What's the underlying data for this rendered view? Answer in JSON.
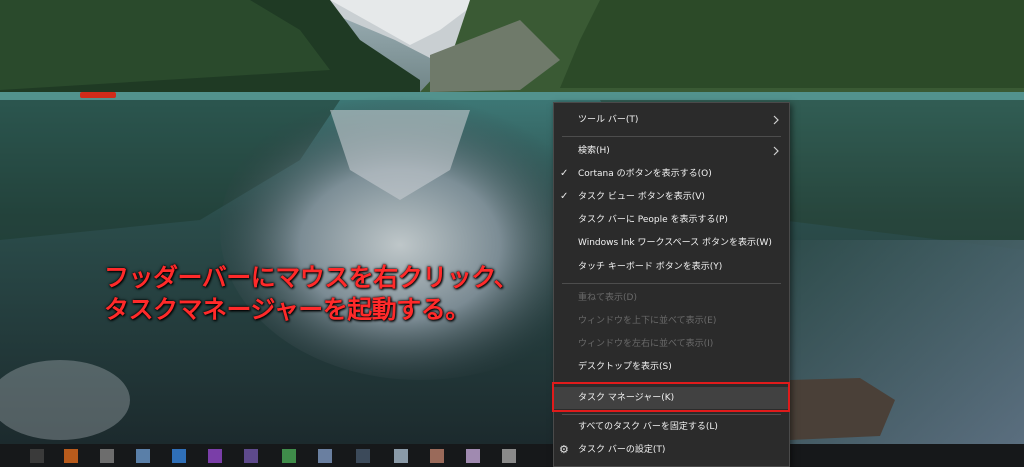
{
  "annotation": {
    "line1": "フッダーバーにマウスを右クリック、",
    "line2": "タスクマネージャーを起動する。"
  },
  "context_menu": {
    "items": [
      {
        "label": "ツール バー(T)",
        "checked": false,
        "disabled": false,
        "submenu": true
      },
      {
        "label": "検索(H)",
        "checked": false,
        "disabled": false,
        "submenu": true
      },
      {
        "label": "Cortana のボタンを表示する(O)",
        "checked": true,
        "disabled": false
      },
      {
        "label": "タスク ビュー ボタンを表示(V)",
        "checked": true,
        "disabled": false
      },
      {
        "label": "タスク バーに People を表示する(P)",
        "checked": false,
        "disabled": false
      },
      {
        "label": "Windows Ink ワークスペース ボタンを表示(W)",
        "checked": false,
        "disabled": false
      },
      {
        "label": "タッチ キーボード ボタンを表示(Y)",
        "checked": false,
        "disabled": false
      },
      {
        "label": "重ねて表示(D)",
        "checked": false,
        "disabled": true
      },
      {
        "label": "ウィンドウを上下に並べて表示(E)",
        "checked": false,
        "disabled": true
      },
      {
        "label": "ウィンドウを左右に並べて表示(I)",
        "checked": false,
        "disabled": true
      },
      {
        "label": "デスクトップを表示(S)",
        "checked": false,
        "disabled": false
      },
      {
        "label": "タスク マネージャー(K)",
        "checked": false,
        "disabled": false,
        "highlighted": true
      },
      {
        "label": "すべてのタスク バーを固定する(L)",
        "checked": false,
        "disabled": false
      },
      {
        "label": "タスク バーの設定(T)",
        "checked": false,
        "disabled": false,
        "icon": "gear-icon"
      }
    ],
    "check_glyph": "✓",
    "gear_glyph": "⚙"
  },
  "colors": {
    "annotation_text": "#ff2a2a",
    "highlight_border": "#e01b1b",
    "menu_bg": "#2b2b2b"
  }
}
